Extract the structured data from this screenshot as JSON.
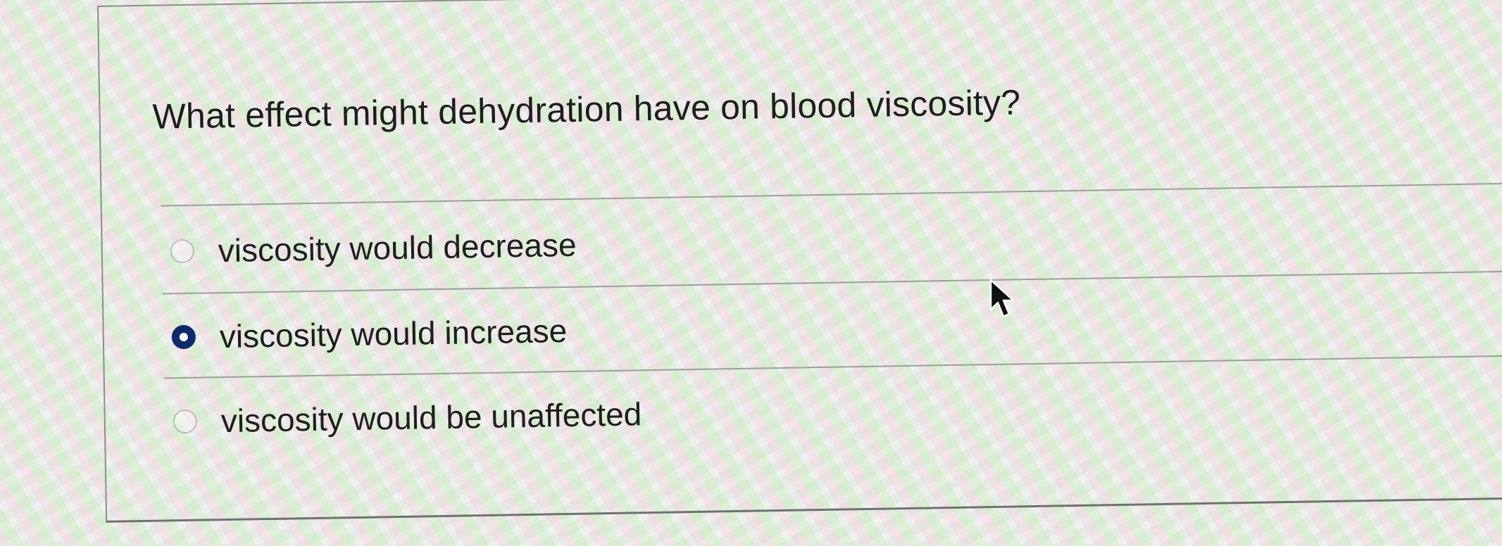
{
  "quiz": {
    "question": "What effect might dehydration have on blood viscosity?",
    "options": [
      {
        "label": "viscosity would decrease",
        "selected": false
      },
      {
        "label": "viscosity would increase",
        "selected": true
      },
      {
        "label": "viscosity would be unaffected",
        "selected": false
      }
    ]
  },
  "colors": {
    "selected_radio": "#0d2a6b",
    "text": "#1e1e1e"
  },
  "icons": {
    "cursor": "mouse-pointer-icon"
  }
}
